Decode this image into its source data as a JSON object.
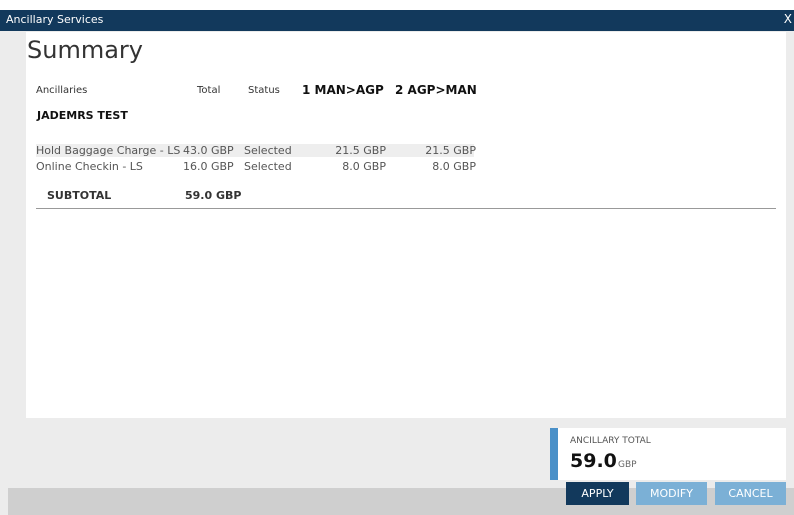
{
  "window": {
    "title": "Ancillary Services",
    "close_label": "X"
  },
  "summary": {
    "title": "Summary",
    "headers": {
      "ancillaries": "Ancillaries",
      "total": "Total",
      "status": "Status",
      "segment1": "1 MAN>AGP",
      "segment2": "2 AGP>MAN"
    },
    "passenger": "JADEMRS TEST",
    "rows": [
      {
        "name": "Hold Baggage Charge - LS",
        "total": "43.0 GBP",
        "status": "Selected",
        "seg1": "21.5 GBP",
        "seg2": "21.5 GBP"
      },
      {
        "name": "Online Checkin - LS",
        "total": "16.0 GBP",
        "status": "Selected",
        "seg1": "8.0 GBP",
        "seg2": "8.0 GBP"
      }
    ],
    "subtotal_label": "SUBTOTAL",
    "subtotal_value": "59.0 GBP"
  },
  "ancillary_total": {
    "label": "ANCILLARY TOTAL",
    "value": "59.0",
    "currency": "GBP"
  },
  "buttons": {
    "apply": "APPLY",
    "modify": "MODIFY",
    "cancel": "CANCEL"
  },
  "colors": {
    "titlebar": "#12395c",
    "accent": "#4a90c8",
    "apply": "#12395c",
    "secondary_button": "#7bb0d6"
  }
}
